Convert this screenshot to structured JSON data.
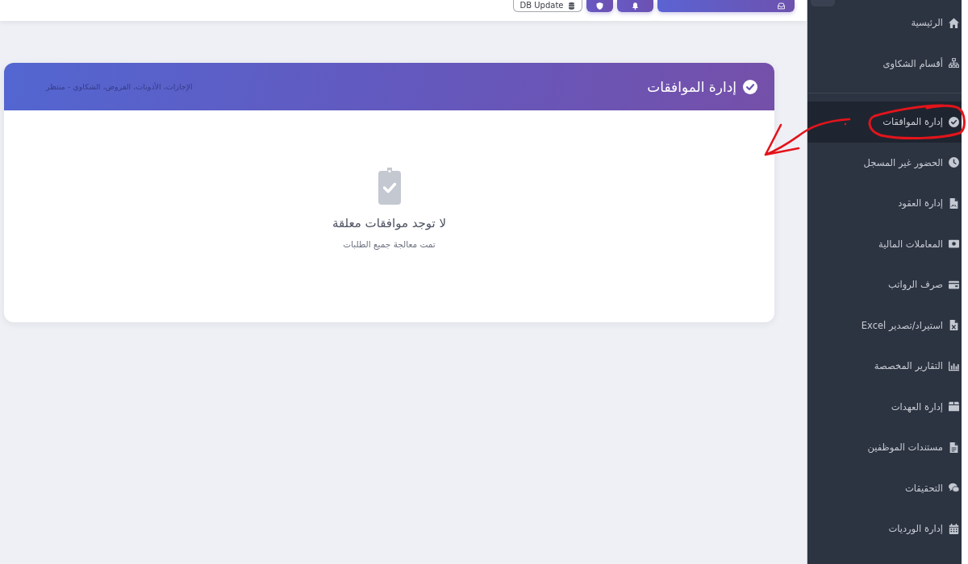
{
  "top_bar": {
    "buttons": [
      {
        "kind": "primary"
      },
      {
        "kind": "icon"
      },
      {
        "kind": "icon"
      },
      {
        "kind": "outline",
        "label": "DB Update"
      }
    ]
  },
  "card": {
    "title": "إدارة الموافقات",
    "subtitle": "الإجازات، الأذونات، القروض، الشكاوى - منتظر",
    "empty_state": {
      "title": "لا توجد موافقات معلقة",
      "message": "تمت معالجة جميع الطلبات"
    }
  },
  "sidebar": {
    "sections": [
      {
        "items": [
          {
            "label": "الرئيسية",
            "selected": false,
            "circled": false
          },
          {
            "label": "أقسام الشكاوى",
            "selected": false,
            "circled": false
          }
        ]
      },
      {
        "items": [
          {
            "label": "إدارة الموافقات",
            "selected": true,
            "circled": true
          },
          {
            "label": "الحضور غير المسجل",
            "selected": false,
            "circled": false
          },
          {
            "label": "إدارة العقود",
            "selected": false,
            "circled": false
          },
          {
            "label": "المعاملات المالية",
            "selected": false,
            "circled": false
          },
          {
            "label": "صرف الرواتب",
            "selected": false,
            "circled": false
          },
          {
            "label": "استيراد/تصدير Excel",
            "selected": false,
            "circled": false
          },
          {
            "label": "التقارير المخصصة",
            "selected": false,
            "circled": false
          },
          {
            "label": "إدارة العهدات",
            "selected": false,
            "circled": false
          },
          {
            "label": "مستندات الموظفين",
            "selected": false,
            "circled": false
          },
          {
            "label": "التحقيقات",
            "selected": false,
            "circled": false
          },
          {
            "label": "إدارة الورديات",
            "selected": false,
            "circled": false
          }
        ]
      }
    ]
  }
}
